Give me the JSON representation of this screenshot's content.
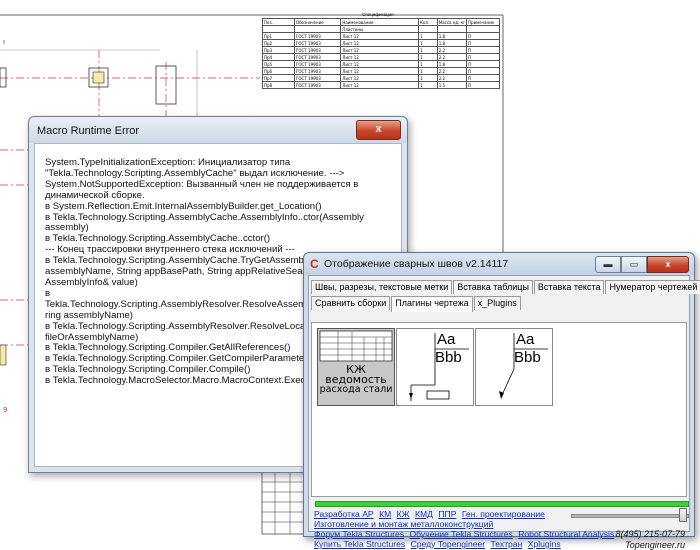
{
  "spec": {
    "title": "Спецификация",
    "headers": [
      "Поз.",
      "Обозначение",
      "Наименование",
      "Кол.",
      "Масса ед. кг",
      "Примечание"
    ],
    "group": "Пластины",
    "rows": [
      [
        "Пр1",
        "ГОСТ 19903",
        "Лист 12",
        "1",
        "1.8",
        "П"
      ],
      [
        "Пр2",
        "ГОСТ 19903",
        "Лист 12",
        "1",
        "1.8",
        "П"
      ],
      [
        "Пр3",
        "ГОСТ 19903",
        "Лист 12",
        "1",
        "2.2",
        "П"
      ],
      [
        "Пр4",
        "ГОСТ 19903",
        "Лист 12",
        "1",
        "2.2",
        "П"
      ],
      [
        "Пр5",
        "ГОСТ 19903",
        "Лист 12",
        "1",
        "1.8",
        "П"
      ],
      [
        "Пр6",
        "ГОСТ 19903",
        "Лист 12",
        "1",
        "2.2",
        "П"
      ],
      [
        "Пр7",
        "ГОСТ 19903",
        "Лист 12",
        "1",
        "2.2",
        "П"
      ],
      [
        "Пр8",
        "ГОСТ 19903",
        "Лист 12",
        "1",
        "1.5",
        "П"
      ]
    ]
  },
  "error_window": {
    "title": "Macro Runtime Error",
    "close_label": "x",
    "lines": [
      "System.TypeInitializationException: Инициализатор типа",
      "\"Tekla.Technology.Scripting.AssemblyCache\" выдал исключение. --->",
      "System.NotSupportedException: Вызванный член не поддерживается в",
      "динамической сборке.",
      "   в System.Reflection.Emit.InternalAssemblyBuilder.get_Location()",
      "   в Tekla.Technology.Scripting.AssemblyCache.AssemblyInfo..ctor(Assembly",
      "assembly)",
      "   в Tekla.Technology.Scripting.AssemblyCache..cctor()",
      "   --- Конец трассировки внутреннего стека исключений ---",
      "   в Tekla.Technology.Scripting.AssemblyCache.TryGetAssemblyInfo(String",
      "assemblyName, String appBasePath, String appRelativeSearchPath,",
      "AssemblyInfo& value)",
      "   в",
      "Tekla.Technology.Scripting.AssemblyResolver.ResolveAssembly(Str",
      "ring assemblyName)",
      "   в Tekla.Technology.Scripting.AssemblyResolver.ResolveLocation(",
      "fileOrAssemblyName)",
      "   в Tekla.Technology.Scripting.Compiler.GetAllReferences()",
      "   в Tekla.Technology.Scripting.Compiler.GetCompilerParameters(",
      "   в Tekla.Technology.Scripting.Compiler.Compile()",
      "   в Tekla.Technology.MacroSelector.Macro.MacroContext.Execute"
    ]
  },
  "plugin_window": {
    "title": "Отображение сварных швов v2.14117",
    "minimize_label": "▬",
    "maximize_label": "▭",
    "close_label": "x",
    "tabs_row1": [
      "Швы, разрезы, текстовые метки",
      "Вставка таблицы",
      "Вставка текста",
      "Нумератор чертежей"
    ],
    "tabs_row2": [
      "Сравнить сборки",
      "Плагины чертежа",
      "x_Plugins"
    ],
    "active_tab": "Плагины чертежа",
    "tile1": {
      "line1": "КЖ",
      "line2": "ведомость",
      "line3": "расхода стали"
    },
    "tile_text_top": "Aa",
    "tile_text_bottom": "Bbb",
    "links_row1": [
      "Разработка АР",
      "КМ",
      "КЖ",
      "КМД",
      "ППР",
      "Ген. проектирование"
    ],
    "links_row2": [
      "Изготовление и монтаж металлоконструкций"
    ],
    "links_row3": [
      "Форум Tekla Structures",
      "Обучение Tekla Structures",
      "Robot Structural Analysis"
    ],
    "links_row4": [
      "Купить Tekla Structures",
      "Среду Topengineer",
      "Техтран",
      "Xplugins"
    ],
    "phone": "8(495) 215-07-79",
    "site": "Topengineer.ru",
    "progress": 1.0
  },
  "colors": {
    "progress": "#39d039",
    "link": "#0b2fbf",
    "close": "#c8452a"
  }
}
